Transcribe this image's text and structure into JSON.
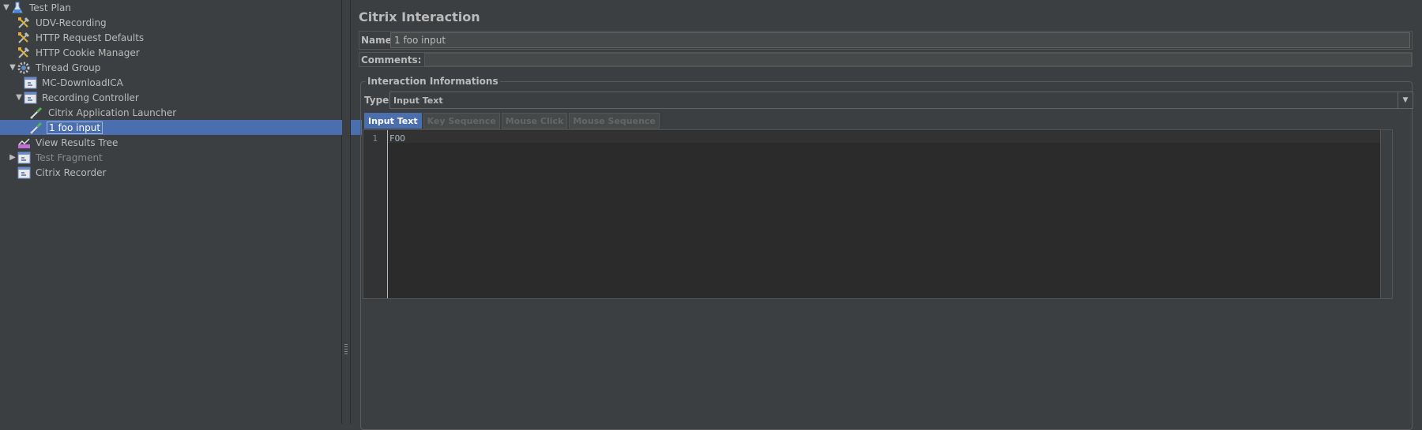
{
  "tree": {
    "items": [
      {
        "label": "Test Plan",
        "icon": "flask-icon",
        "toggle": "▼",
        "indent": 0
      },
      {
        "label": "UDV-Recording",
        "icon": "wrench-icon",
        "toggle": "",
        "indent": 1
      },
      {
        "label": "HTTP Request Defaults",
        "icon": "wrench-icon",
        "toggle": "",
        "indent": 1
      },
      {
        "label": "HTTP Cookie Manager",
        "icon": "wrench-icon",
        "toggle": "",
        "indent": 1
      },
      {
        "label": "Thread Group",
        "icon": "gear-icon",
        "toggle": "▼",
        "indent": 1
      },
      {
        "label": "MC-DownloadICA",
        "icon": "controller-icon",
        "toggle": "",
        "indent": 2
      },
      {
        "label": "Recording Controller",
        "icon": "controller-icon",
        "toggle": "▼",
        "indent": 2
      },
      {
        "label": "Citrix Application Launcher",
        "icon": "pipette-icon",
        "toggle": "",
        "indent": 3
      },
      {
        "label": "1 foo input",
        "icon": "pipette-icon",
        "toggle": "",
        "indent": 3,
        "selected": true
      },
      {
        "label": "View Results Tree",
        "icon": "chart-icon",
        "toggle": "",
        "indent": 1
      },
      {
        "label": "Test Fragment",
        "icon": "controller-icon",
        "toggle": "▶",
        "indent": 1,
        "disabled": true
      },
      {
        "label": "Citrix Recorder",
        "icon": "controller-icon",
        "toggle": "",
        "indent": 1
      }
    ]
  },
  "panel": {
    "title": "Citrix Interaction",
    "name_label": "Name:",
    "name_value": "1 foo input",
    "comments_label": "Comments:",
    "group_title": "Interaction Informations",
    "type_label": "Type :",
    "type_value": "Input Text",
    "tabs": [
      {
        "label": "Input Text",
        "active": true
      },
      {
        "label": "Key Sequence",
        "active": false
      },
      {
        "label": "Mouse Click",
        "active": false
      },
      {
        "label": "Mouse Sequence",
        "active": false
      }
    ],
    "editor": {
      "line_number": "1",
      "text": "FOO"
    }
  },
  "colors": {
    "background": "#3c3f41",
    "selection": "#4b6eaf",
    "editor_bg": "#2b2b2b",
    "text": "#bbbbbb"
  }
}
